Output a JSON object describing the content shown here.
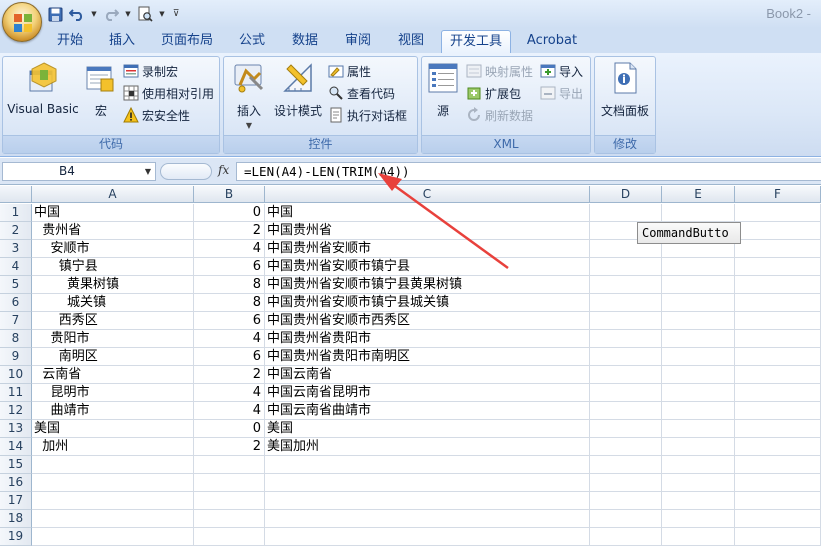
{
  "window": {
    "title": "Book2 -"
  },
  "colors": {
    "accent": "#15428b",
    "arrow": "#e8413c"
  },
  "tabs": [
    "开始",
    "插入",
    "页面布局",
    "公式",
    "数据",
    "审阅",
    "视图",
    "开发工具",
    "Acrobat"
  ],
  "active_tab": "开发工具",
  "ribbon": {
    "code": {
      "label": "代码",
      "visual_basic": "Visual Basic",
      "macros": "宏",
      "record_macro": "录制宏",
      "relative_ref": "使用相对引用",
      "macro_security": "宏安全性"
    },
    "controls": {
      "label": "控件",
      "insert": "插入",
      "design_mode": "设计模式",
      "properties": "属性",
      "view_code": "查看代码",
      "run_dialog": "执行对话框"
    },
    "xml": {
      "label": "XML",
      "source": "源",
      "map_properties": "映射属性",
      "expansion_packs": "扩展包",
      "refresh_data": "刷新数据",
      "import": "导入",
      "export": "导出"
    },
    "modify": {
      "label": "修改",
      "document_panel": "文档面板"
    }
  },
  "formula_bar": {
    "name_box": "B4",
    "fx": "fx",
    "formula": "=LEN(A4)-LEN(TRIM(A4))"
  },
  "columns": [
    "A",
    "B",
    "C",
    "D",
    "E",
    "F"
  ],
  "rows": [
    {
      "n": "1",
      "a": "中国",
      "b": "0",
      "c": "中国"
    },
    {
      "n": "2",
      "a": "  贵州省",
      "b": "2",
      "c": "中国贵州省"
    },
    {
      "n": "3",
      "a": "    安顺市",
      "b": "4",
      "c": "中国贵州省安顺市"
    },
    {
      "n": "4",
      "a": "      镇宁县",
      "b": "6",
      "c": "中国贵州省安顺市镇宁县"
    },
    {
      "n": "5",
      "a": "        黄果树镇",
      "b": "8",
      "c": "中国贵州省安顺市镇宁县黄果树镇"
    },
    {
      "n": "6",
      "a": "        城关镇",
      "b": "8",
      "c": "中国贵州省安顺市镇宁县城关镇"
    },
    {
      "n": "7",
      "a": "      西秀区",
      "b": "6",
      "c": "中国贵州省安顺市西秀区"
    },
    {
      "n": "8",
      "a": "    贵阳市",
      "b": "4",
      "c": "中国贵州省贵阳市"
    },
    {
      "n": "9",
      "a": "      南明区",
      "b": "6",
      "c": "中国贵州省贵阳市南明区"
    },
    {
      "n": "10",
      "a": "  云南省",
      "b": "2",
      "c": "中国云南省"
    },
    {
      "n": "11",
      "a": "    昆明市",
      "b": "4",
      "c": "中国云南省昆明市"
    },
    {
      "n": "12",
      "a": "    曲靖市",
      "b": "4",
      "c": "中国云南省曲靖市"
    },
    {
      "n": "13",
      "a": "美国",
      "b": "0",
      "c": "美国"
    },
    {
      "n": "14",
      "a": "  加州",
      "b": "2",
      "c": "美国加州"
    },
    {
      "n": "15",
      "a": "",
      "b": "",
      "c": ""
    },
    {
      "n": "16",
      "a": "",
      "b": "",
      "c": ""
    },
    {
      "n": "17",
      "a": "",
      "b": "",
      "c": ""
    },
    {
      "n": "18",
      "a": "",
      "b": "",
      "c": ""
    },
    {
      "n": "19",
      "a": "",
      "b": "",
      "c": ""
    }
  ],
  "command_button": "CommandButto",
  "icons": [
    "office-button-icon",
    "save-icon",
    "undo-icon",
    "redo-icon",
    "print-preview-icon",
    "customize-qat-icon",
    "arrow-annotation"
  ]
}
